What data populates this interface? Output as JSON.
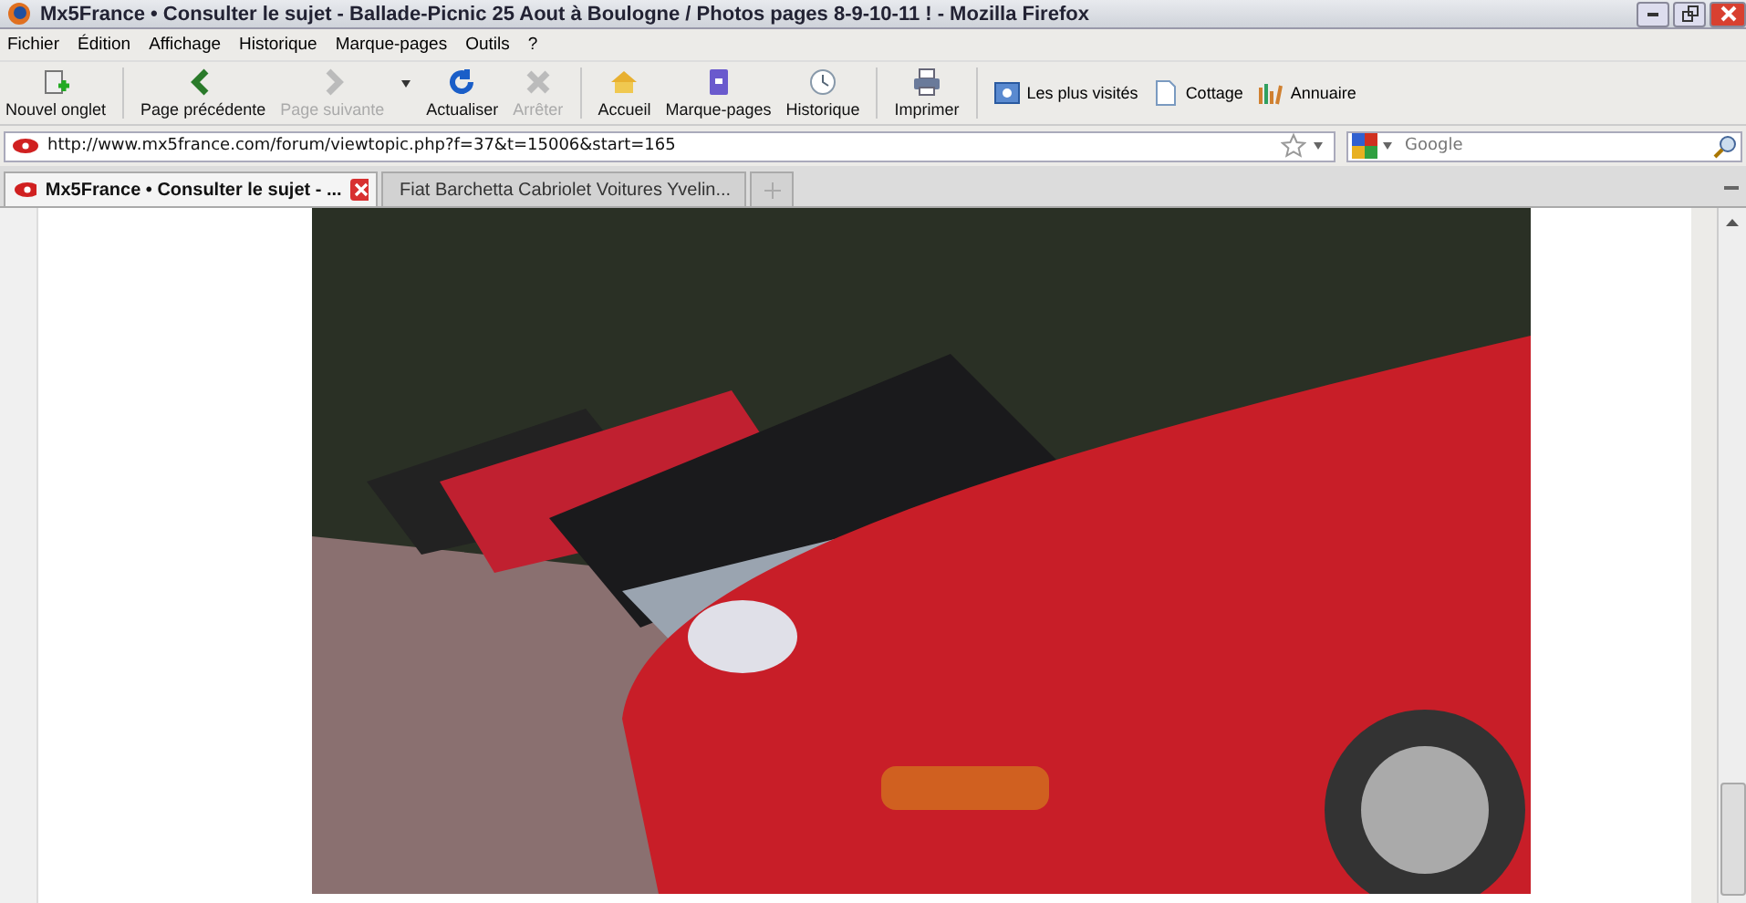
{
  "window": {
    "title": "Mx5France • Consulter le sujet - Ballade-Picnic 25 Aout à Boulogne / Photos pages 8-9-10-11 ! - Mozilla Firefox"
  },
  "menu": [
    "Fichier",
    "Édition",
    "Affichage",
    "Historique",
    "Marque-pages",
    "Outils",
    "?"
  ],
  "toolbar": [
    {
      "label": "Nouvel onglet",
      "kind": "newtab",
      "disabled": false
    },
    {
      "label": "Page précédente",
      "kind": "back",
      "disabled": false
    },
    {
      "label": "Page suivante",
      "kind": "forward",
      "disabled": true
    },
    {
      "label": "Actualiser",
      "kind": "reload",
      "disabled": false
    },
    {
      "label": "Arrêter",
      "kind": "stop",
      "disabled": true
    },
    {
      "label": "Accueil",
      "kind": "home",
      "disabled": false
    },
    {
      "label": "Marque-pages",
      "kind": "bookmarks",
      "disabled": false
    },
    {
      "label": "Historique",
      "kind": "history",
      "disabled": false
    },
    {
      "label": "Imprimer",
      "kind": "print",
      "disabled": false
    }
  ],
  "bookmarks": [
    {
      "label": "Les plus visités",
      "kind": "smart"
    },
    {
      "label": "Cottage",
      "kind": "page"
    },
    {
      "label": "Annuaire",
      "kind": "chart"
    }
  ],
  "address": {
    "value": "http://www.mx5france.com/forum/viewtopic.php?f=37&t=15006&start=165"
  },
  "search": {
    "placeholder": "Google"
  },
  "tabs": [
    {
      "label": "Mx5France • Consulter le sujet - ...",
      "selected": true
    },
    {
      "label": "Fiat Barchetta Cabriolet Voitures Yvelin...",
      "selected": false
    }
  ]
}
